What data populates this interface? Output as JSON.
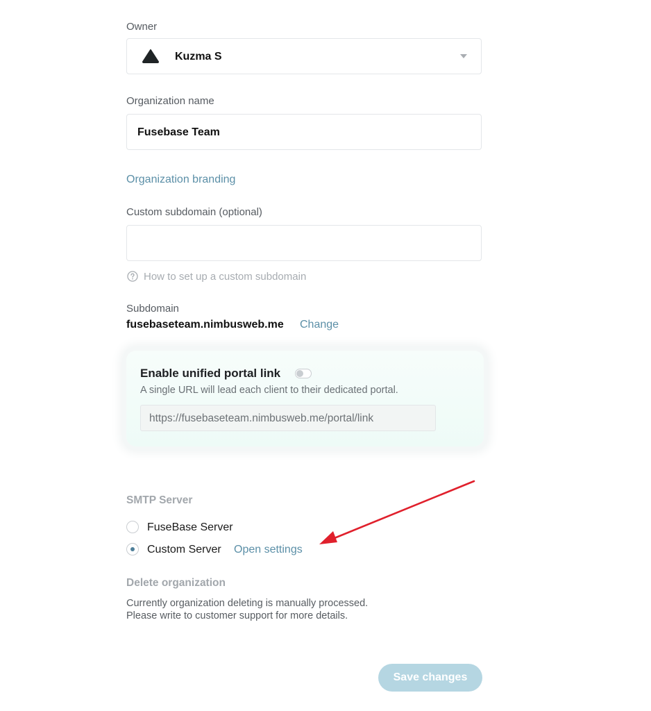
{
  "owner": {
    "label": "Owner",
    "name": "Kuzma S"
  },
  "organization": {
    "label": "Organization name",
    "value": "Fusebase Team"
  },
  "branding_link": "Organization branding",
  "custom_subdomain": {
    "label": "Custom subdomain (optional)",
    "value": "",
    "help_text": "How to set up a custom subdomain"
  },
  "subdomain": {
    "label": "Subdomain",
    "value": "fusebaseteam.nimbusweb.me",
    "change_link": "Change"
  },
  "portal": {
    "title": "Enable unified portal link",
    "enabled": false,
    "description": "A single URL will lead each client to their dedicated portal.",
    "url": "https://fusebaseteam.nimbusweb.me/portal/link"
  },
  "smtp": {
    "heading": "SMTP Server",
    "options": [
      {
        "label": "FuseBase Server",
        "selected": false
      },
      {
        "label": "Custom Server",
        "selected": true
      }
    ],
    "open_settings": "Open settings"
  },
  "delete_org": {
    "heading": "Delete organization",
    "line1": "Currently organization deleting is manually processed.",
    "line2": "Please write to customer support for more details."
  },
  "save_button": "Save changes",
  "colors": {
    "link": "#5b8fa7",
    "save_button": "#b5d6e2",
    "annotation_arrow": "#e0202c"
  }
}
